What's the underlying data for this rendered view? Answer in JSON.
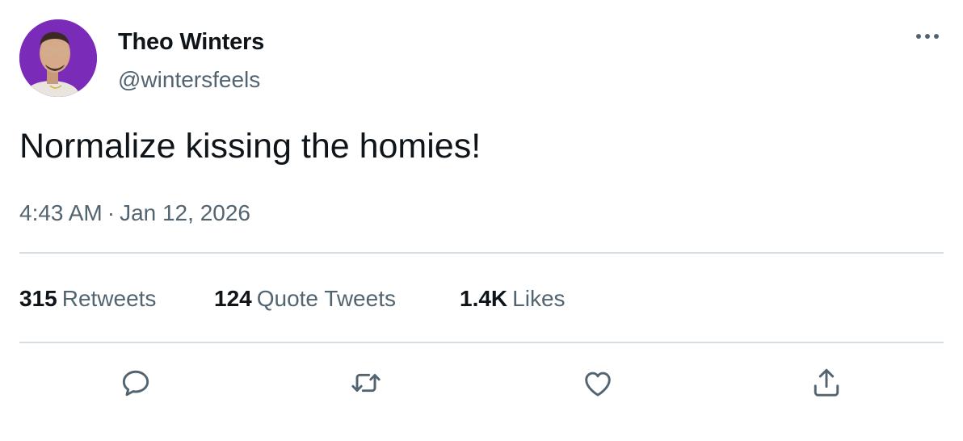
{
  "user": {
    "display_name": "Theo Winters",
    "handle": "@wintersfeels",
    "avatar_bg": "#7a2bb8"
  },
  "tweet": {
    "text": "Normalize kissing the homies!",
    "time": "4:43 AM",
    "separator": "·",
    "date": "Jan 12, 2026"
  },
  "stats": {
    "retweets": {
      "count": "315",
      "label": "Retweets"
    },
    "quotes": {
      "count": "124",
      "label": "Quote Tweets"
    },
    "likes": {
      "count": "1.4K",
      "label": "Likes"
    }
  },
  "actions": {
    "icons": [
      "reply-icon",
      "retweet-icon",
      "like-icon",
      "share-icon",
      "more-icon"
    ]
  },
  "colors": {
    "text_primary": "#0f1419",
    "text_secondary": "#536471",
    "divider": "#d6dee3"
  }
}
